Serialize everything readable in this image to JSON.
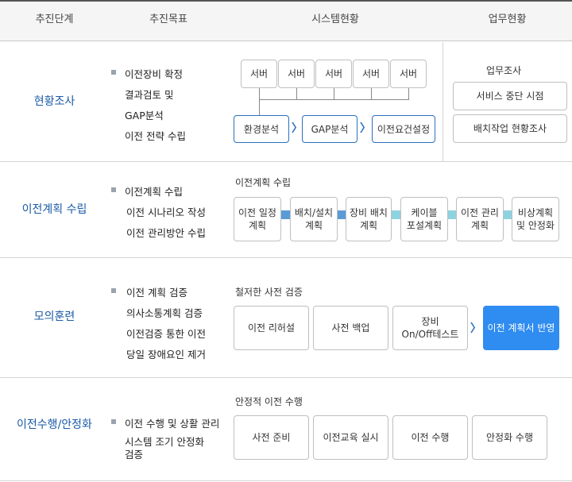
{
  "header": {
    "stage": "추진단계",
    "goal": "추진목표",
    "system": "시스템현황",
    "business": "업무현황"
  },
  "rows": [
    {
      "stage": "현황조사",
      "goals": [
        "이전장비 확정",
        "결과검토 및",
        "GAP분석",
        "이전 전략 수립"
      ],
      "servers": [
        "서버",
        "서버",
        "서버",
        "서버",
        "서버"
      ],
      "steps": [
        "환경분석",
        "GAP분석",
        "이전요건설정"
      ],
      "business": {
        "title": "업무조사",
        "items": [
          "서비스 중단 시점",
          "배치작업 현황조사"
        ]
      }
    },
    {
      "stage": "이전계획 수립",
      "goals": [
        "이전계획 수립",
        "이전 시나리오 작성",
        "이전 관리방안 수립"
      ],
      "section_title": "이전계획 수립",
      "steps": [
        "이전 일정\n계획",
        "배치/설치\n계획",
        "장비 배치\n계획",
        "케이블\n포설계획",
        "이전 관리\n계획",
        "비상계획\n및 안정화"
      ]
    },
    {
      "stage": "모의훈련",
      "goals": [
        "이전 계획 검증",
        "의사소통계획 검증",
        "이전검증 통한 이전",
        "당일 장애요인 제거"
      ],
      "section_title": "철저한 사전 검증",
      "steps": [
        "이전 리허설",
        "사전 백업",
        "장비\nOn/Off테스트",
        "이전 계획서 반영"
      ]
    },
    {
      "stage": "이전수행/안정화",
      "goals": [
        "이전 수행 및 상활 관리",
        "시스템 조기 안정화\n검증"
      ],
      "section_title": "안정적 이전 수행",
      "steps": [
        "사전 준비",
        "이전교육 실시",
        "이전 수행",
        "안정화 수행"
      ]
    }
  ],
  "colors": {
    "stage_text": "#1a5aa6",
    "accent": "#2f8cf0",
    "connector_row2_a": "#5b9bd5",
    "connector_row2_b": "#8fd3e0"
  }
}
